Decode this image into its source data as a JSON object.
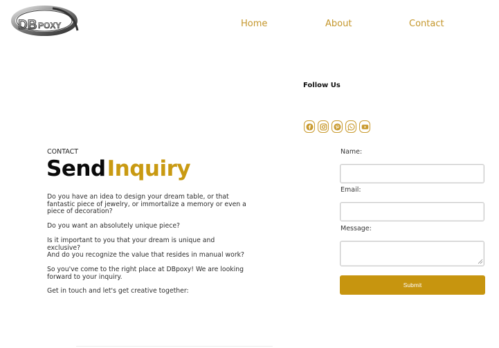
{
  "header": {
    "logo": {
      "text": "DBpoxy",
      "icon": "dbpoxy-logo"
    },
    "nav": [
      {
        "label": "Home"
      },
      {
        "label": "About"
      },
      {
        "label": "Contact"
      }
    ]
  },
  "follow": {
    "title": "Follow Us",
    "icons": [
      "facebook-icon",
      "instagram-icon",
      "pinterest-icon",
      "whatsapp-icon",
      "youtube-icon"
    ]
  },
  "intro": {
    "eyebrow": "CONTACT",
    "headline_part1": "Send",
    "headline_part2": "Inquiry",
    "paragraphs": [
      "Do you have an idea to design your dream table, or that fantastic piece of jewelry, or immortalize a memory or even a piece of decoration?",
      "Do you want an absolutely unique piece?",
      "Is it important to you that your dream is unique and exclusive?",
      "And do you recognize the value that resides in manual work?",
      "So you've come to the right place at DBpoxy! We are looking forward to your inquiry.",
      "Get in touch and let's get creative together:"
    ]
  },
  "form": {
    "name_label": "Name:",
    "email_label": "Email:",
    "message_label": "Message:",
    "submit_label": "Submit"
  },
  "colors": {
    "accent": "#c99a12",
    "nav": "#c4962b",
    "button": "#c7950f"
  }
}
